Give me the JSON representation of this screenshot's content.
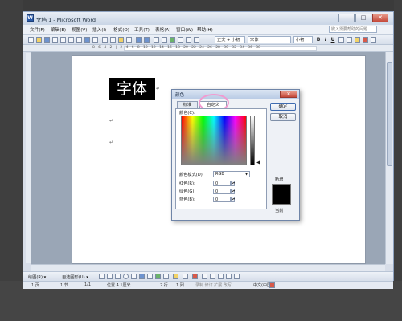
{
  "app": {
    "window_title": "文档 1 - Microsoft Word",
    "app_icon": "W",
    "buttons": {
      "minimize": "–",
      "maximize": "□",
      "close": "✕"
    }
  },
  "menubar": {
    "items": [
      "文件(F)",
      "编辑(E)",
      "视图(V)",
      "插入(I)",
      "格式(O)",
      "工具(T)",
      "表格(A)",
      "窗口(W)",
      "帮助(H)"
    ],
    "help_placeholder": "键入需要帮助的问题"
  },
  "toolbar": {
    "style_value": "正文 + 小初",
    "font_value": "宋体",
    "size_value": "小初",
    "bold": "B",
    "italic": "I",
    "underline": "U"
  },
  "ruler": {
    "ticks": "8 · 6 · 4 · 2 · | · 2 · 4 · 6 · 8 · 10 · 12 · 14 · 16 · 18 · 20 · 22 · 24 · 26 · 28 · 30 · 32 · 34 · 36 · 38"
  },
  "document": {
    "heading_text": "字体",
    "paragraph_marks": [
      "↵",
      "↵",
      "↵"
    ]
  },
  "drawing_toolbar": {
    "draw_label": "绘图(R) ▾",
    "autoshapes_label": "自选图形(U) ▾"
  },
  "statusbar": {
    "page": "1 页",
    "section": "1 节",
    "page_of": "1/1",
    "position": "位置 4.1厘米",
    "line": "2 行",
    "column": "1 列",
    "modes": "录制  修订  扩展  改写",
    "language": "中文(中国)"
  },
  "color_dialog": {
    "title": "颜色",
    "close_glyph": "✕",
    "tabs": [
      "标准",
      "自定义"
    ],
    "active_tab": "自定义",
    "colors_label": "颜色(C):",
    "color_mode_label": "颜色模式(D):",
    "color_mode_value": "RGB",
    "red_label": "红色(R):",
    "green_label": "绿色(G):",
    "blue_label": "蓝色(B):",
    "red_value": "0",
    "green_value": "0",
    "blue_value": "0",
    "ok_label": "确定",
    "cancel_label": "取消",
    "new_label": "新增",
    "current_label": "当前",
    "new_color": "#000000",
    "current_color": "#000000",
    "highlight_color": "#f29ad0"
  }
}
